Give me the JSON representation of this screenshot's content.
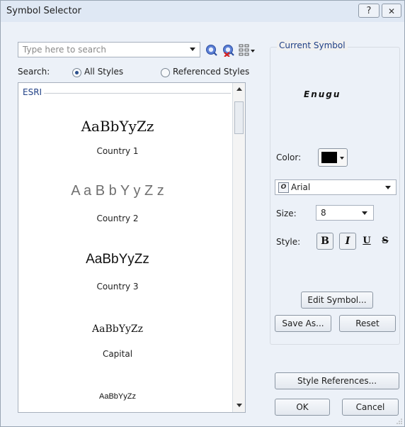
{
  "window": {
    "title": "Symbol Selector",
    "help_glyph": "?",
    "close_glyph": "✕"
  },
  "search": {
    "placeholder": "Type here to search",
    "label": "Search:"
  },
  "scope": {
    "all_styles": "All Styles",
    "referenced_styles": "Referenced Styles",
    "selected": "All Styles"
  },
  "list": {
    "group": "ESRI",
    "items": [
      {
        "sample": "AaBbYyZz",
        "name": "Country 1"
      },
      {
        "sample": "A a B b Y y Z z",
        "name": "Country 2"
      },
      {
        "sample": "AaBbYyZz",
        "name": "Country 3"
      },
      {
        "sample": "AaBbYyZz",
        "name": "Capital"
      },
      {
        "sample": "AaBbYyZz",
        "name": ""
      }
    ]
  },
  "current_symbol": {
    "title": "Current Symbol",
    "preview": "Enugu",
    "color_label": "Color:",
    "color": "#000000",
    "font": "Arial",
    "size_label": "Size:",
    "size": "8",
    "style_label": "Style:",
    "bold": "B",
    "italic": "I",
    "underline": "U",
    "strikethrough": "S",
    "edit_symbol": "Edit Symbol...",
    "save_as": "Save As...",
    "reset": "Reset"
  },
  "footer": {
    "style_references": "Style References...",
    "ok": "OK",
    "cancel": "Cancel"
  },
  "icons": [
    "zoom-to-icon",
    "zoom-delete-icon",
    "view-options-icon"
  ]
}
